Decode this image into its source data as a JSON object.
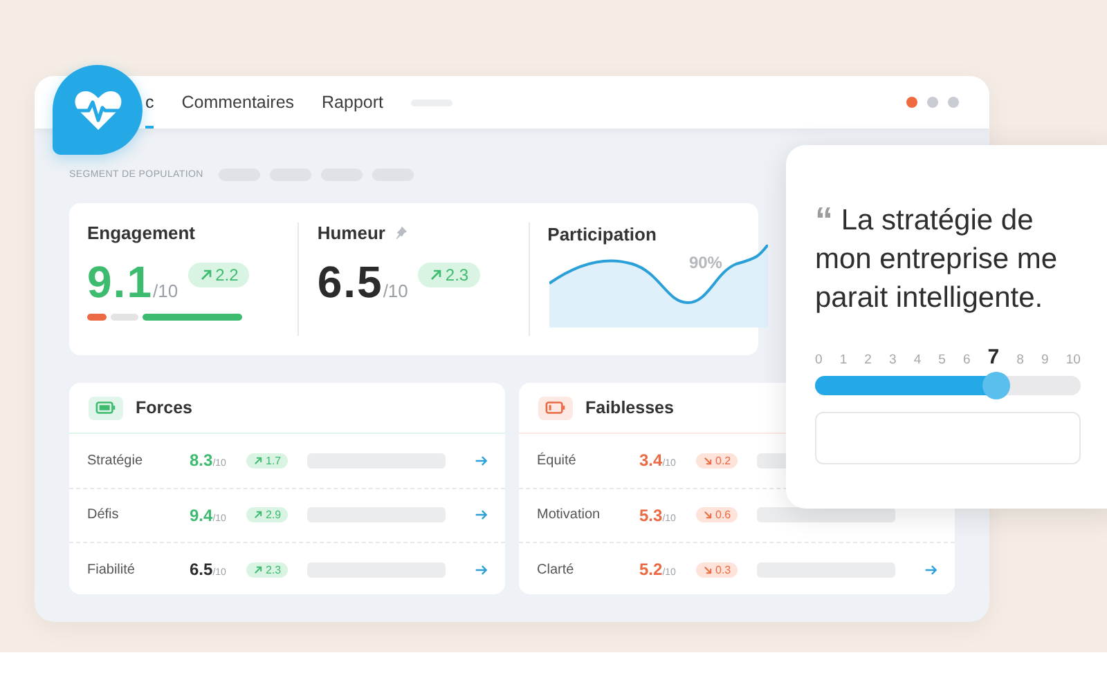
{
  "tabs": [
    {
      "label": "c",
      "selected": true
    },
    {
      "label": "Commentaires",
      "selected": false
    },
    {
      "label": "Rapport",
      "selected": false
    }
  ],
  "window_controls": [
    {
      "color": "#f06a3f"
    },
    {
      "color": "#c9ccd2"
    },
    {
      "color": "#c9ccd2"
    }
  ],
  "segment": {
    "label": "SEGMENT DE POPULATION"
  },
  "kpis": [
    {
      "kind": "score",
      "title": "Engagement",
      "value": "9.1",
      "scale": "/10",
      "color": "#3dbb6f",
      "delta": "2.2",
      "rising": true
    },
    {
      "kind": "score",
      "title": "Humeur",
      "pinned": true,
      "value": "6.5",
      "scale": "/10",
      "color": "#2b2b2b",
      "delta": "2.3",
      "rising": true
    },
    {
      "kind": "chart",
      "title": "Participation",
      "reading": "90%"
    }
  ],
  "panels": [
    {
      "title": "Forces",
      "color": "#3dbb6f",
      "rows": [
        {
          "label": "Stratégie",
          "score": "8.3",
          "scale": "/10",
          "color": "#3dbb6f",
          "delta": "1.7",
          "rising": true,
          "link": true
        },
        {
          "label": "Défis",
          "score": "9.4",
          "scale": "/10",
          "color": "#3dbb6f",
          "delta": "2.9",
          "rising": true,
          "link": true
        },
        {
          "label": "Fiabilité",
          "score": "6.5",
          "scale": "/10",
          "color": "#2b2b2b",
          "delta": "2.3",
          "rising": true,
          "link": true
        }
      ]
    },
    {
      "title": "Faiblesses",
      "color": "#ec6a43",
      "rows": [
        {
          "label": "Équité",
          "score": "3.4",
          "scale": "/10",
          "color": "#ec6a43",
          "delta": "0.2",
          "rising": false,
          "link": false
        },
        {
          "label": "Motivation",
          "score": "5.3",
          "scale": "/10",
          "color": "#ec6a43",
          "delta": "0.6",
          "rising": false,
          "link": false
        },
        {
          "label": "Clarté",
          "score": "5.2",
          "scale": "/10",
          "color": "#ec6a43",
          "delta": "0.3",
          "rising": false,
          "link": true
        }
      ]
    }
  ],
  "question": {
    "quote_mark": "“",
    "text": "La stratégie de mon entreprise me parait intelligente.",
    "scale": [
      {
        "label": "0",
        "selected": false
      },
      {
        "label": "1",
        "selected": false
      },
      {
        "label": "2",
        "selected": false
      },
      {
        "label": "3",
        "selected": false
      },
      {
        "label": "4",
        "selected": false
      },
      {
        "label": "5",
        "selected": false
      },
      {
        "label": "6",
        "selected": false
      },
      {
        "label": "7",
        "selected": true
      },
      {
        "label": "8",
        "selected": false
      },
      {
        "label": "9",
        "selected": false
      },
      {
        "label": "10",
        "selected": false
      }
    ],
    "level": 0.68
  }
}
